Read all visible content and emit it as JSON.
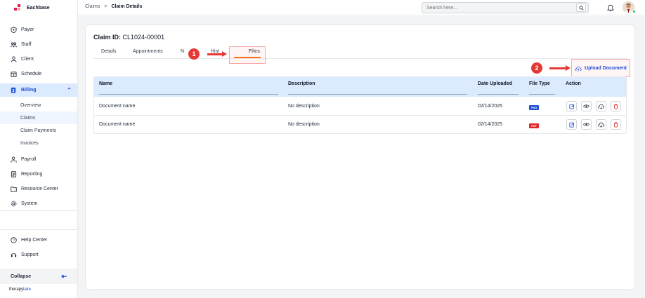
{
  "brand": {
    "name": "Eachbase"
  },
  "sidebar": {
    "items": [
      {
        "label": "Payer",
        "icon": "shield-icon"
      },
      {
        "label": "Staff",
        "icon": "staff-icon"
      },
      {
        "label": "Client",
        "icon": "user-icon"
      },
      {
        "label": "Schedule",
        "icon": "calendar-icon"
      },
      {
        "label": "Billing",
        "icon": "billing-icon"
      },
      {
        "label": "Payroll",
        "icon": "payroll-icon"
      },
      {
        "label": "Reporting",
        "icon": "report-icon"
      },
      {
        "label": "Resource Center",
        "icon": "folder-icon"
      },
      {
        "label": "System",
        "icon": "gear-icon"
      }
    ],
    "billing_sub": [
      "Overview",
      "Claims",
      "Claim Payments",
      "Invoices"
    ],
    "bottom": [
      {
        "label": "Help Center",
        "icon": "help-icon"
      },
      {
        "label": "Support",
        "icon": "headset-icon"
      }
    ],
    "collapse_label": "Collapse",
    "footer_logo_a": "therapy",
    "footer_logo_b": "lake"
  },
  "topbar": {
    "breadcrumb_parent": "Claims",
    "breadcrumb_sep": ">",
    "breadcrumb_current": "Claim Details",
    "search_placeholder": "Search here..."
  },
  "main": {
    "claim_label": "Claim ID:",
    "claim_id": "CL1024-00001",
    "tabs": [
      "Details",
      "Appointments",
      "N",
      "Hist",
      "Files"
    ],
    "active_tab": "Files",
    "upload_label": "Upload Document",
    "callouts": [
      "1",
      "2"
    ],
    "accent": "#f97316",
    "table": {
      "headers": [
        "Name",
        "Description",
        "Date Uploaded",
        "File Type",
        "Action"
      ],
      "rows": [
        {
          "name": "Document name",
          "description": "No description",
          "date": "02/14/2025",
          "type": "PNG",
          "type_color": "#1d4ed8"
        },
        {
          "name": "Document name",
          "description": "No description",
          "date": "02/14/2025",
          "type": "PDF",
          "type_color": "#dc2626"
        }
      ]
    }
  }
}
